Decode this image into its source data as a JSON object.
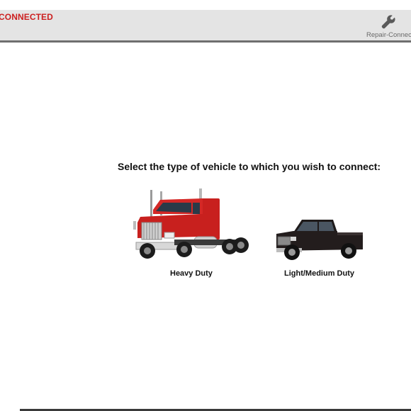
{
  "header": {
    "status_text": "CONNECTED",
    "status_color": "#cc1f1f",
    "repair_label": "Repair-Connect",
    "repair_icon": "wrench-icon"
  },
  "main": {
    "prompt": "Select the type of vehicle to which you wish to connect:",
    "options": [
      {
        "label": "Heavy Duty",
        "icon": "semi-truck-icon",
        "color": "#c8201e"
      },
      {
        "label": "Light/Medium Duty",
        "icon": "pickup-truck-icon",
        "color": "#1e1a1a"
      }
    ]
  }
}
